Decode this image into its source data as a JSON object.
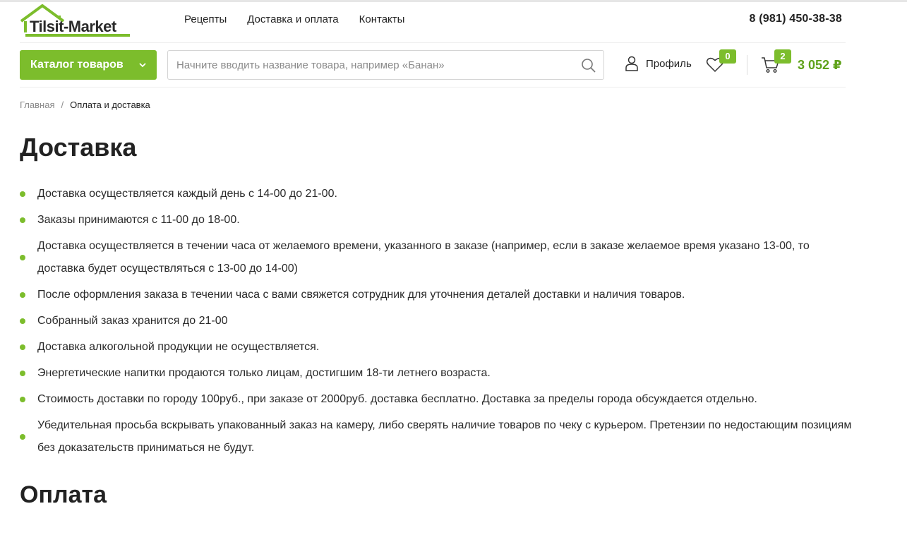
{
  "brand": {
    "logo_text": "Tilsit-Market",
    "accent_color": "#7cbd2c",
    "price_color": "#5fa21a"
  },
  "topnav": {
    "items": [
      "Рецепты",
      "Доставка и оплата",
      "Контакты"
    ]
  },
  "header": {
    "phone": "8 (981) 450-38-38",
    "catalog_button": "Каталог товаров",
    "search_placeholder": "Начните вводить название товара, например «Банан»",
    "search_value": "",
    "profile_label": "Профиль",
    "favorites_count": "0",
    "cart_count": "2",
    "cart_total": "3 052 ₽"
  },
  "breadcrumb": {
    "home": "Главная",
    "separator": "/",
    "current": "Оплата и доставка"
  },
  "content": {
    "delivery_title": "Доставка",
    "delivery_items": [
      "Доставка осуществляется каждый день с 14-00 до 21-00.",
      "Заказы принимаются с 11-00 до 18-00.",
      "Доставка осуществляется в течении часа от желаемого времени, указанного в заказе (например, если в заказе желаемое время указано 13-00, то доставка будет осуществляться с 13-00 до 14-00)",
      "После оформления заказа в течении часа с вами свяжется сотрудник для уточнения деталей доставки и наличия товаров.",
      "Собранный заказ хранится до 21-00",
      "Доставка алкогольной продукции не осуществляется.",
      "Энергетические напитки продаются только лицам, достигшим 18-ти летнего возраста.",
      "Стоимость доставки по городу 100руб., при заказе от 2000руб. доставка бесплатно. Доставка за пределы города обсуждается отдельно.",
      "Убедительная просьба вскрывать упакованный заказ на камеру, либо сверять наличие товаров по чеку с курьером. Претензии по недостающим позициям без доказательств приниматься не будут."
    ],
    "payment_title": "Оплата"
  },
  "icons": {
    "logo": "house-roof-logo-icon",
    "catalog_chevron": "chevron-down-icon",
    "search": "search-icon",
    "profile": "user-icon",
    "favorites": "heart-icon",
    "cart": "cart-icon"
  }
}
